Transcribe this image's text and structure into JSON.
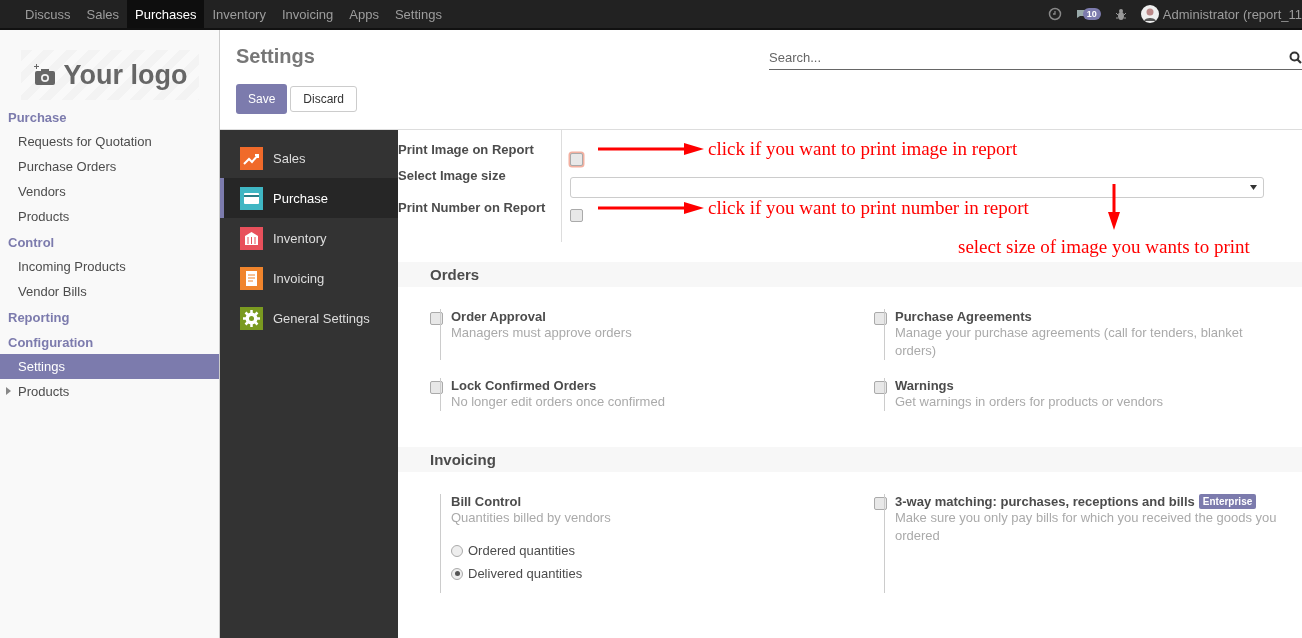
{
  "navbar": {
    "menu": [
      {
        "label": "Discuss",
        "selected": false
      },
      {
        "label": "Sales",
        "selected": false
      },
      {
        "label": "Purchases",
        "selected": true
      },
      {
        "label": "Inventory",
        "selected": false
      },
      {
        "label": "Invoicing",
        "selected": false
      },
      {
        "label": "Apps",
        "selected": false
      },
      {
        "label": "Settings",
        "selected": false
      }
    ],
    "message_count": "10",
    "user": "Administrator (report_11"
  },
  "sidebar": {
    "logo": "Your logo",
    "sections": [
      {
        "title": "Purchase",
        "items": [
          {
            "label": "Requests for Quotation",
            "selected": false
          },
          {
            "label": "Purchase Orders",
            "selected": false
          },
          {
            "label": "Vendors",
            "selected": false
          },
          {
            "label": "Products",
            "selected": false
          }
        ]
      },
      {
        "title": "Control",
        "items": [
          {
            "label": "Incoming Products",
            "selected": false
          },
          {
            "label": "Vendor Bills",
            "selected": false
          }
        ]
      },
      {
        "title": "Reporting"
      },
      {
        "title": "Configuration",
        "items": [
          {
            "label": "Settings",
            "selected": true
          },
          {
            "label": "Products",
            "selected": false,
            "expanded": false
          }
        ]
      }
    ]
  },
  "control_panel": {
    "title": "Settings",
    "save": "Save",
    "discard": "Discard",
    "search": {
      "placeholder": "Search..."
    }
  },
  "apps": [
    {
      "label": "Sales",
      "selected": false,
      "color": "#f06a2a",
      "kind": "chart"
    },
    {
      "label": "Purchase",
      "selected": true,
      "color": "#3fb6c3",
      "kind": "card"
    },
    {
      "label": "Inventory",
      "selected": false,
      "color": "#e8505b",
      "kind": "building"
    },
    {
      "label": "Invoicing",
      "selected": false,
      "color": "#f0842c",
      "kind": "document"
    },
    {
      "label": "General Settings",
      "selected": false,
      "color": "#7a9a20",
      "kind": "gear"
    }
  ],
  "report_options": [
    {
      "label": "Print Image on Report",
      "kind": "checkbox",
      "checked": false,
      "focused": true
    },
    {
      "label": "Select Image size",
      "kind": "select"
    },
    {
      "label": "Print Number on Report",
      "kind": "checkbox",
      "checked": false,
      "focused": false
    }
  ],
  "annotations": [
    {
      "text": "click if you want to print image in report",
      "kind": "arrow-right"
    },
    {
      "text": "click if you want to print number in report",
      "kind": "arrow-right"
    },
    {
      "text": "select size of image you wants to print",
      "kind": "arrow-down"
    }
  ],
  "sections": [
    {
      "title": "Orders",
      "settings": [
        {
          "kind": "checkbox",
          "title": "Order Approval",
          "description": "Managers must approve orders",
          "checked": false
        },
        {
          "kind": "checkbox",
          "title": "Purchase Agreements",
          "description": "Manage your purchase agreements (call for tenders, blanket orders)",
          "checked": false
        },
        {
          "kind": "checkbox",
          "title": "Lock Confirmed Orders",
          "description": "No longer edit orders once confirmed",
          "checked": false
        },
        {
          "kind": "checkbox",
          "title": "Warnings",
          "description": "Get warnings in orders for products or vendors",
          "checked": false
        }
      ]
    },
    {
      "title": "Invoicing",
      "settings": [
        {
          "kind": "radio-group",
          "title": "Bill Control",
          "description": "Quantities billed by vendors",
          "options": [
            {
              "label": "Ordered quantities",
              "selected": false
            },
            {
              "label": "Delivered quantities",
              "selected": true
            }
          ]
        },
        {
          "kind": "checkbox",
          "title": "3-way matching: purchases, receptions and bills",
          "badge": "Enterprise",
          "description": "Make sure you only pay bills for which you received the goods you ordered",
          "checked": false
        }
      ]
    }
  ]
}
